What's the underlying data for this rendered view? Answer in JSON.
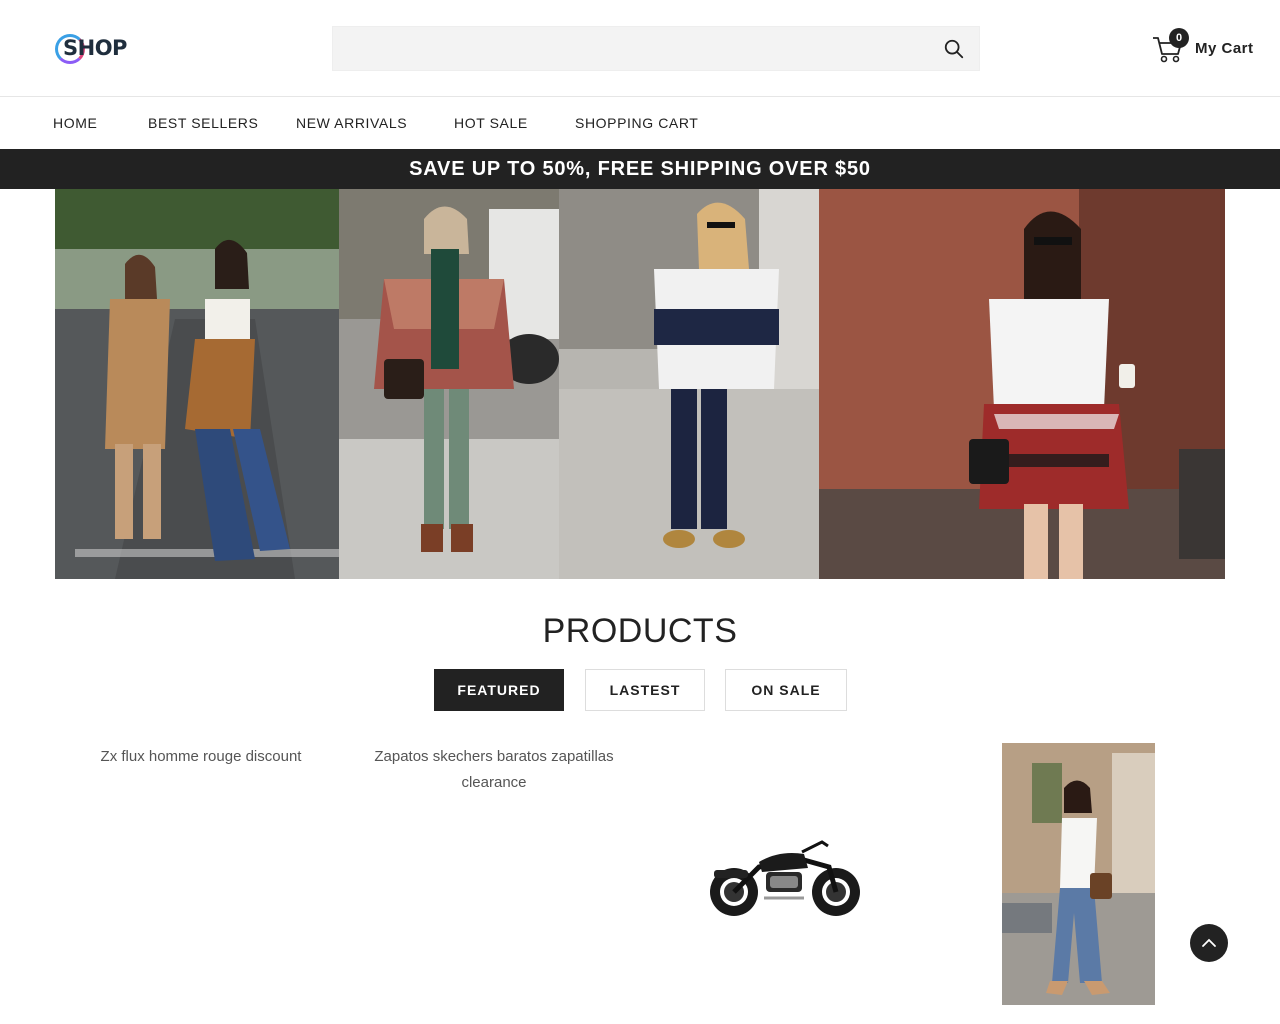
{
  "header": {
    "logo_text": "SHOP",
    "search": {
      "placeholder": "",
      "value": ""
    },
    "cart": {
      "count": "0",
      "label": "My Cart"
    }
  },
  "nav": {
    "items": [
      "HOME",
      "BEST SELLERS",
      "NEW ARRIVALS",
      "HOT SALE",
      "SHOPPING CART"
    ]
  },
  "promo": {
    "text": "SAVE UP TO 50%, FREE SHIPPING OVER $50"
  },
  "products": {
    "title": "PRODUCTS",
    "tabs": [
      "FEATURED",
      "LASTEST",
      "ON SALE"
    ],
    "active_tab": "FEATURED",
    "items": [
      {
        "name": "Zx flux homme rouge discount"
      },
      {
        "name": "Zapatos skechers baratos zapatillas clearance"
      }
    ]
  },
  "colors": {
    "dark": "#222222",
    "search_bg": "#f3f3f3",
    "border": "#e6e6e6"
  }
}
